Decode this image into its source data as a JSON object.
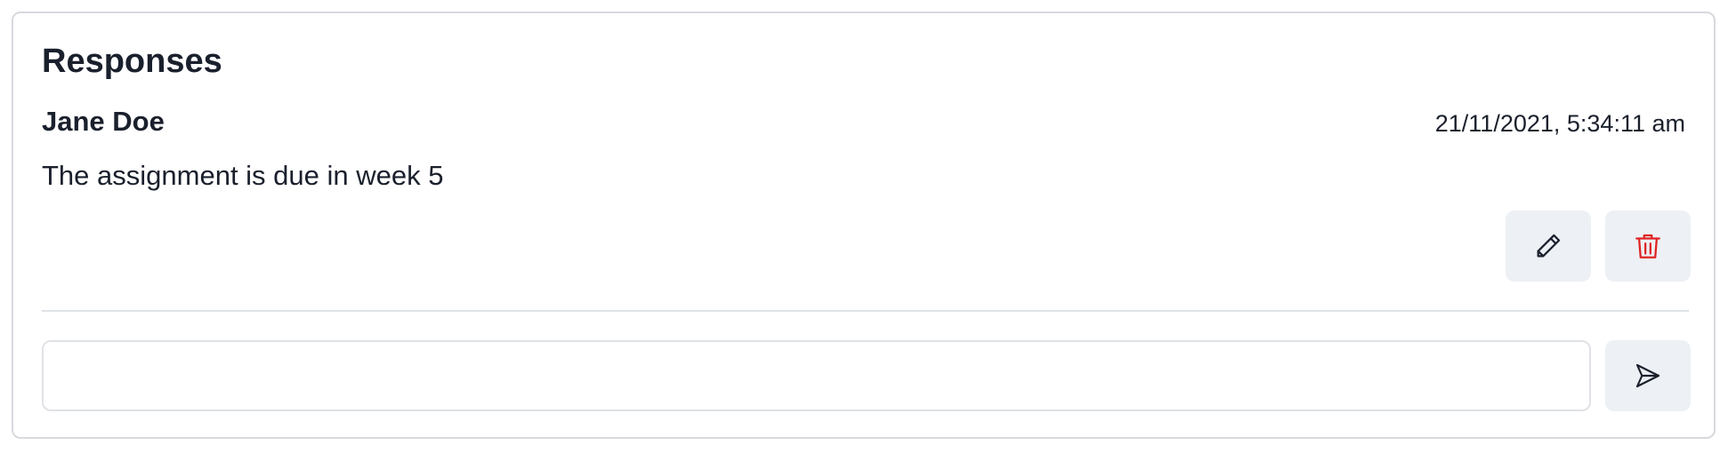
{
  "section": {
    "title": "Responses"
  },
  "response": {
    "author": "Jane Doe",
    "timestamp": "21/11/2021, 5:34:11 am",
    "message": "The assignment is due in week 5",
    "actions": {
      "edit_icon": "pencil-icon",
      "delete_icon": "trash-icon"
    }
  },
  "reply": {
    "value": "",
    "placeholder": "",
    "send_icon": "send-icon"
  },
  "colors": {
    "text": "#1a202c",
    "button_bg": "#edf0f4",
    "delete": "#e02424",
    "border": "#d7d9dd"
  }
}
